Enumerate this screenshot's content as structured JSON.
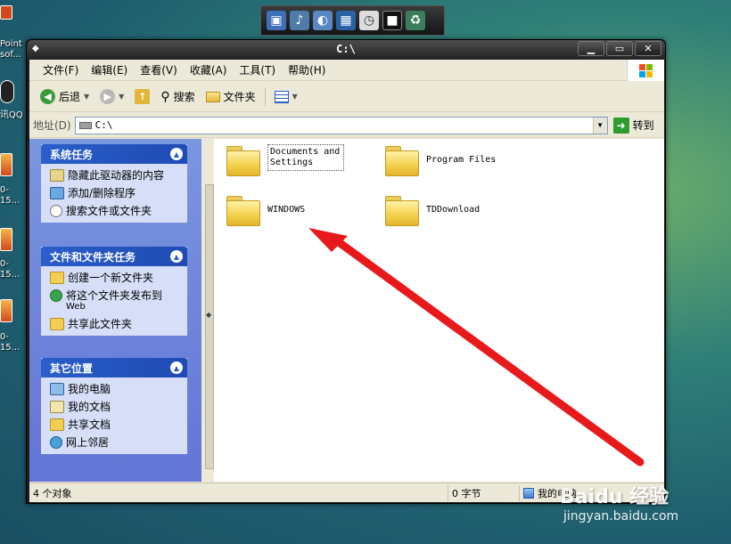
{
  "desktop": {
    "items": [
      {
        "label": "Point\nsof..."
      },
      {
        "label": "讯QQ"
      },
      {
        "label": "0-15..."
      },
      {
        "label": "0-15..."
      },
      {
        "label": "0-15..."
      }
    ]
  },
  "window": {
    "title": "C:\\",
    "menu": [
      "文件(F)",
      "编辑(E)",
      "查看(V)",
      "收藏(A)",
      "工具(T)",
      "帮助(H)"
    ],
    "toolbar": {
      "back": "后退",
      "search": "搜索",
      "folders": "文件夹"
    },
    "address": {
      "label": "地址(D)",
      "value": "C:\\",
      "go": "转到"
    },
    "tasks": [
      {
        "title": "系统任务",
        "items": [
          {
            "label": "隐藏此驱动器的内容",
            "icon": "hide-drive-icon"
          },
          {
            "label": "添加/删除程序",
            "icon": "add-remove-programs-icon"
          },
          {
            "label": "搜索文件或文件夹",
            "icon": "search-files-icon"
          }
        ]
      },
      {
        "title": "文件和文件夹任务",
        "items": [
          {
            "label": "创建一个新文件夹",
            "icon": "new-folder-icon"
          },
          {
            "label": "将这个文件夹发布到",
            "sub": "Web",
            "icon": "publish-web-icon"
          },
          {
            "label": "共享此文件夹",
            "icon": "share-folder-icon"
          }
        ]
      },
      {
        "title": "其它位置",
        "items": [
          {
            "label": "我的电脑",
            "icon": "my-computer-icon"
          },
          {
            "label": "我的文档",
            "icon": "my-documents-icon"
          },
          {
            "label": "共享文档",
            "icon": "shared-documents-icon"
          },
          {
            "label": "网上邻居",
            "icon": "network-places-icon"
          }
        ]
      }
    ],
    "folders": [
      {
        "name": "Documents and\nSettings"
      },
      {
        "name": "Program Files"
      },
      {
        "name": "WINDOWS"
      },
      {
        "name": "TDDownload"
      }
    ],
    "status": {
      "count": "4 个对象",
      "size": "0 字节",
      "location": "我的电脑"
    }
  },
  "watermark": {
    "brand": "Baidu 经验",
    "url": "jingyan.baidu.com"
  },
  "colors": {
    "arrow": "#e8191b",
    "taskHeader": "#2a5ec9",
    "taskPane": "#6f86da"
  }
}
